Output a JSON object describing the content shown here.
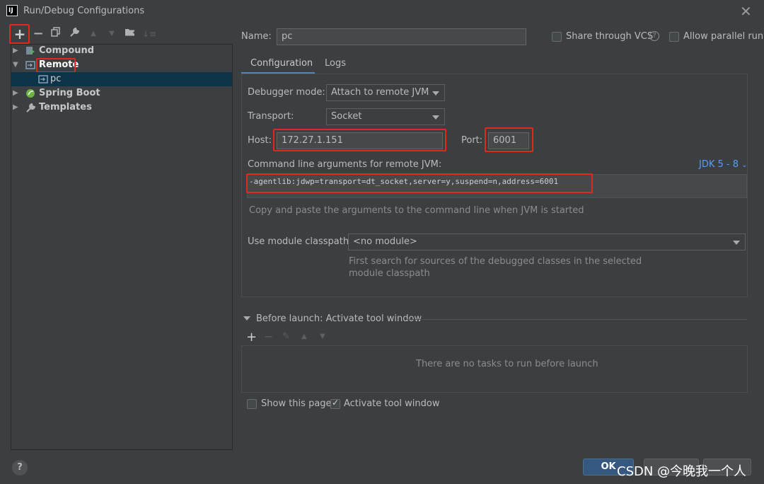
{
  "window": {
    "title": "Run/Debug Configurations",
    "app_icon_text": "IJ"
  },
  "toolbar": {
    "icons": [
      "add-icon",
      "remove-icon",
      "copy-icon",
      "wrench-icon",
      "move-up-icon",
      "move-down-icon",
      "folder-icon",
      "sort-icon"
    ]
  },
  "tree": {
    "items": [
      {
        "label": "Compound",
        "icon": "compound-icon",
        "expanded": false
      },
      {
        "label": "Remote",
        "icon": "remote-icon",
        "expanded": true
      },
      {
        "label": "pc",
        "icon": "remote-config-icon",
        "selected": true
      },
      {
        "label": "Spring Boot",
        "icon": "spring-boot-icon",
        "expanded": false
      },
      {
        "label": "Templates",
        "icon": "wrench-icon",
        "expanded": false
      }
    ]
  },
  "form": {
    "name_label": "Name:",
    "name_value": "pc",
    "share_vcs_label": "Share through VCS",
    "allow_parallel_label": "Allow parallel run",
    "tabs": [
      "Configuration",
      "Logs"
    ],
    "debugger_mode_label": "Debugger mode:",
    "debugger_mode_value": "Attach to remote JVM",
    "transport_label": "Transport:",
    "transport_value": "Socket",
    "host_label": "Host:",
    "host_value": "172.27.1.151",
    "port_label": "Port:",
    "port_value": "6001",
    "cmd_label": "Command line arguments for remote JVM:",
    "jdk_label": "JDK 5 - 8",
    "cmd_value": "-agentlib:jdwp=transport=dt_socket,server=y,suspend=n,address=6001",
    "cmd_hint": "Copy and paste the arguments to the command line when JVM is started",
    "module_label": "Use module classpath:",
    "module_value": "<no module>",
    "module_hint_1": "First search for sources of the debugged classes in the selected",
    "module_hint_2": "module classpath"
  },
  "before_launch": {
    "title": "Before launch: Activate tool window",
    "empty_text": "There are no tasks to run before launch",
    "show_page_label": "Show this page",
    "activate_tool_label": "Activate tool window"
  },
  "buttons": {
    "ok": "OK",
    "help": "?"
  },
  "watermark": "CSDN @今晚我一个人",
  "colors": {
    "accent": "#4a88c7",
    "highlight": "#e0281e",
    "selection": "#0d3349",
    "ok_button": "#365880"
  }
}
